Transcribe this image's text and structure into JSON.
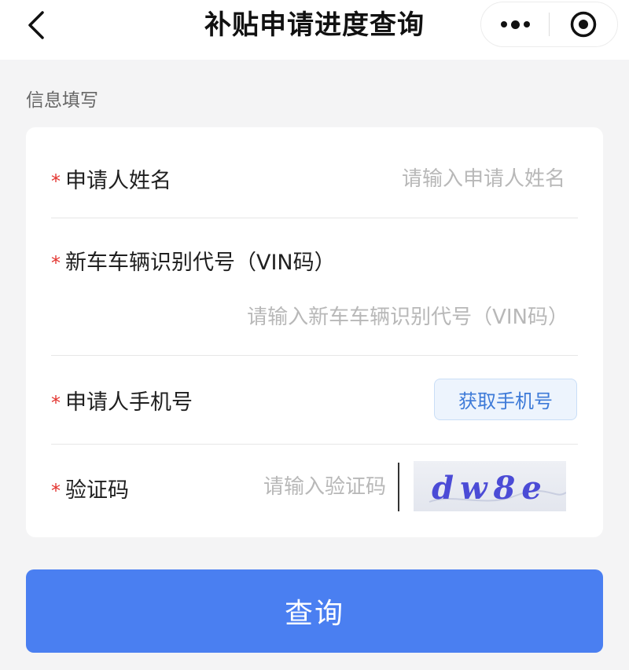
{
  "navbar": {
    "title": "补贴申请进度查询",
    "back_icon": "chevron-left-icon",
    "more_icon": "more-dots-icon",
    "close_icon": "target-circle-icon"
  },
  "section": {
    "label": "信息填写"
  },
  "form": {
    "required_mark": "*",
    "name": {
      "label": "申请人姓名",
      "placeholder": "请输入申请人姓名",
      "value": ""
    },
    "vin": {
      "label": "新车车辆识别代号（VIN码）",
      "placeholder": "请输入新车车辆识别代号（VIN码）",
      "value": ""
    },
    "phone": {
      "label": "申请人手机号",
      "button_label": "获取手机号"
    },
    "captcha": {
      "label": "验证码",
      "placeholder": "请输入验证码",
      "value": "",
      "image_text": "dw8e"
    }
  },
  "actions": {
    "query_label": "查询"
  },
  "colors": {
    "primary": "#4a7ff1",
    "required": "#e3342f",
    "link": "#3d7ad8",
    "background": "#f4f4f5"
  }
}
